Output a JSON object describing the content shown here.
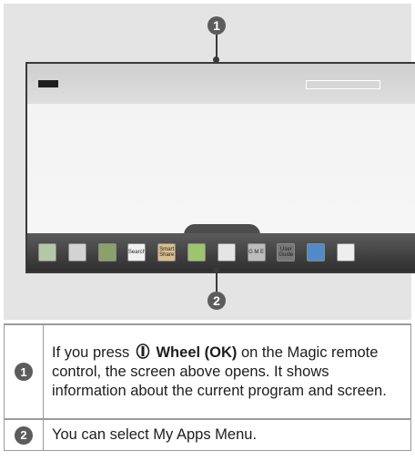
{
  "callouts": [
    {
      "number": "1"
    },
    {
      "number": "2"
    }
  ],
  "screen": {
    "dock_items": [
      {
        "name": "live-tv-icon",
        "label": ""
      },
      {
        "name": "settings-gear-icon",
        "label": ""
      },
      {
        "name": "internet-globe-icon",
        "label": ""
      },
      {
        "name": "search-icon",
        "label": "Search"
      },
      {
        "name": "smartshare-tv-icon",
        "label": "Smart Share"
      },
      {
        "name": "apps-bubbles-icon",
        "label": ""
      },
      {
        "name": "clock-icon",
        "label": ""
      },
      {
        "name": "game-icon",
        "label": "G M E"
      },
      {
        "name": "user-guide-icon",
        "label": "User Guide"
      },
      {
        "name": "input-list-icon",
        "label": ""
      },
      {
        "name": "exit-icon",
        "label": ""
      }
    ]
  },
  "description_table": {
    "rows": [
      {
        "number": "1",
        "text_before": "If you press",
        "bold": "Wheel (OK)",
        "text_after": "on the Magic remote control, the screen above opens. It shows information about the current program and screen."
      },
      {
        "number": "2",
        "text": "You can select My Apps Menu."
      }
    ]
  }
}
